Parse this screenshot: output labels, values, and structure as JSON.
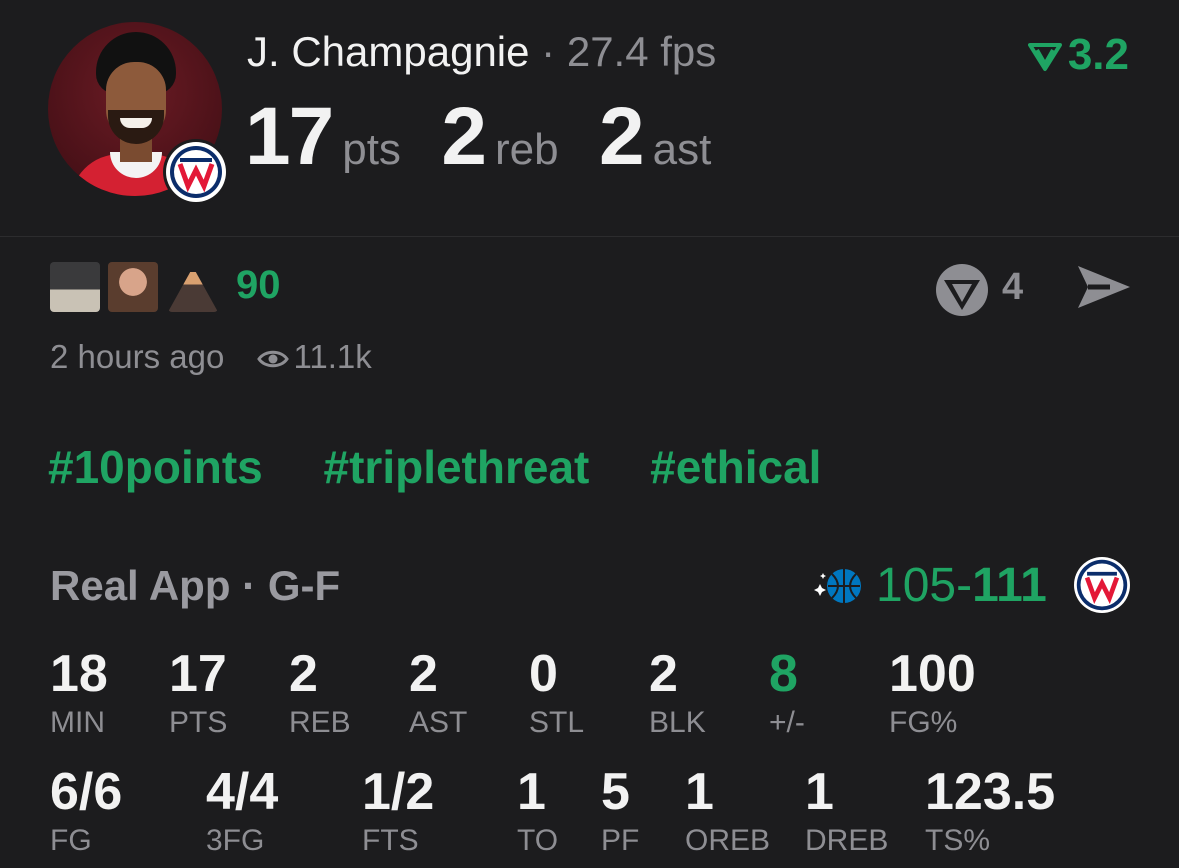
{
  "player": {
    "name": "J. Champagnie",
    "separator": "·",
    "fps": "27.4 fps",
    "score": "3.2",
    "pts_value": "17",
    "pts_label": "pts",
    "reb_value": "2",
    "reb_label": "reb",
    "ast_value": "2",
    "ast_label": "ast"
  },
  "reactions": {
    "count": "90",
    "share_count": "4",
    "emoji_icons": [
      "fist-pump-emoji",
      "face-emoji",
      "volcano-emoji"
    ]
  },
  "meta": {
    "time": "2 hours ago",
    "views": "11.1k"
  },
  "tags": [
    "#10points",
    "#triplethreat",
    "#ethical"
  ],
  "game": {
    "source": "Real App",
    "separator": "·",
    "position": "G-F",
    "score_opponent": "105",
    "dash": "-",
    "score_team": "111"
  },
  "stats_row1": [
    {
      "value": "18",
      "label": "MIN"
    },
    {
      "value": "17",
      "label": "PTS"
    },
    {
      "value": "2",
      "label": "REB"
    },
    {
      "value": "2",
      "label": "AST"
    },
    {
      "value": "0",
      "label": "STL"
    },
    {
      "value": "2",
      "label": "BLK"
    },
    {
      "value": "8",
      "label": "+/-"
    },
    {
      "value": "100",
      "label": "FG%"
    }
  ],
  "stats_row2": [
    {
      "value": "6/6",
      "label": "FG"
    },
    {
      "value": "4/4",
      "label": "3FG"
    },
    {
      "value": "1/2",
      "label": "FTS"
    },
    {
      "value": "1",
      "label": "TO"
    },
    {
      "value": "5",
      "label": "PF"
    },
    {
      "value": "1",
      "label": "OREB"
    },
    {
      "value": "1",
      "label": "DREB"
    },
    {
      "value": "123.5",
      "label": "TS%"
    }
  ],
  "colors": {
    "background": "#1c1c1e",
    "accent_green": "#1fa463",
    "muted": "#8e8e93",
    "wizards_red": "#e31837",
    "wizards_navy": "#0b2d6b",
    "magic_blue": "#0077c0"
  }
}
